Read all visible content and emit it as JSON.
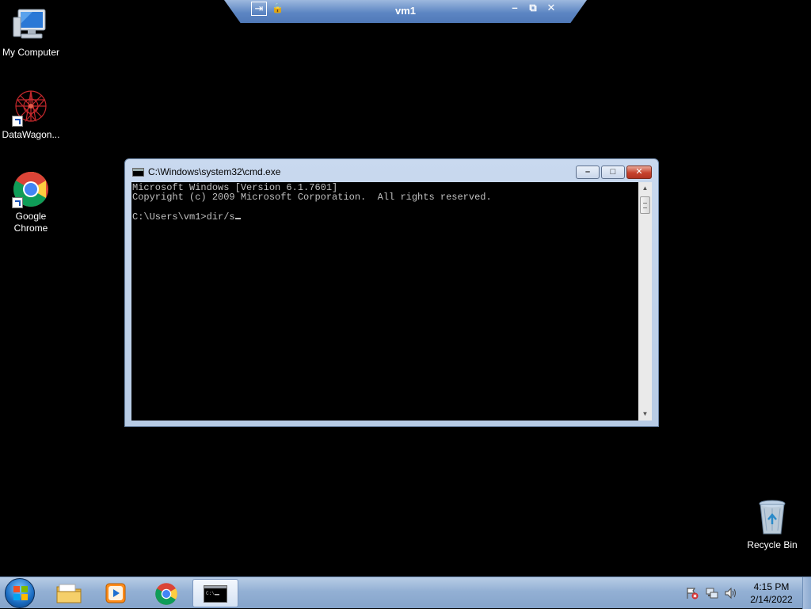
{
  "remote_bar": {
    "title": "vm1",
    "pin_glyph": "⇥",
    "lock_glyph": "🔒",
    "minimize_glyph": "–",
    "restore_glyph": "⧉",
    "close_glyph": "✕"
  },
  "desktop_icons": [
    {
      "label": "My Computer",
      "icon": "computer-icon"
    },
    {
      "label": "DataWagon...",
      "icon": "datawagon-icon"
    },
    {
      "label": "Google Chrome",
      "icon": "chrome-icon"
    },
    {
      "label": "Recycle Bin",
      "icon": "recycle-bin-icon"
    }
  ],
  "cmd": {
    "title": "C:\\Windows\\system32\\cmd.exe",
    "lines": [
      "Microsoft Windows [Version 6.1.7601]",
      "Copyright (c) 2009 Microsoft Corporation.  All rights reserved.",
      "",
      "C:\\Users\\vm1>dir/s"
    ],
    "minimize_glyph": "–",
    "maximize_glyph": "□",
    "close_glyph": "✕"
  },
  "taskbar": {
    "items": [
      {
        "name": "windows-explorer",
        "icon": "folder-icon"
      },
      {
        "name": "media-player",
        "icon": "media-player-icon"
      },
      {
        "name": "google-chrome",
        "icon": "chrome-icon"
      },
      {
        "name": "command-prompt",
        "icon": "cmd-icon",
        "active": true
      }
    ],
    "tray_icons": [
      "action-center-icon",
      "network-icon",
      "volume-icon"
    ],
    "time": "4:15 PM",
    "date": "2/14/2022"
  },
  "colors": {
    "desktop_background": "#000000",
    "console_text": "#c0c0c0",
    "window_frame": "#b7cbe5",
    "close_button": "#c7432d",
    "taskbar": "#93b0d4"
  }
}
